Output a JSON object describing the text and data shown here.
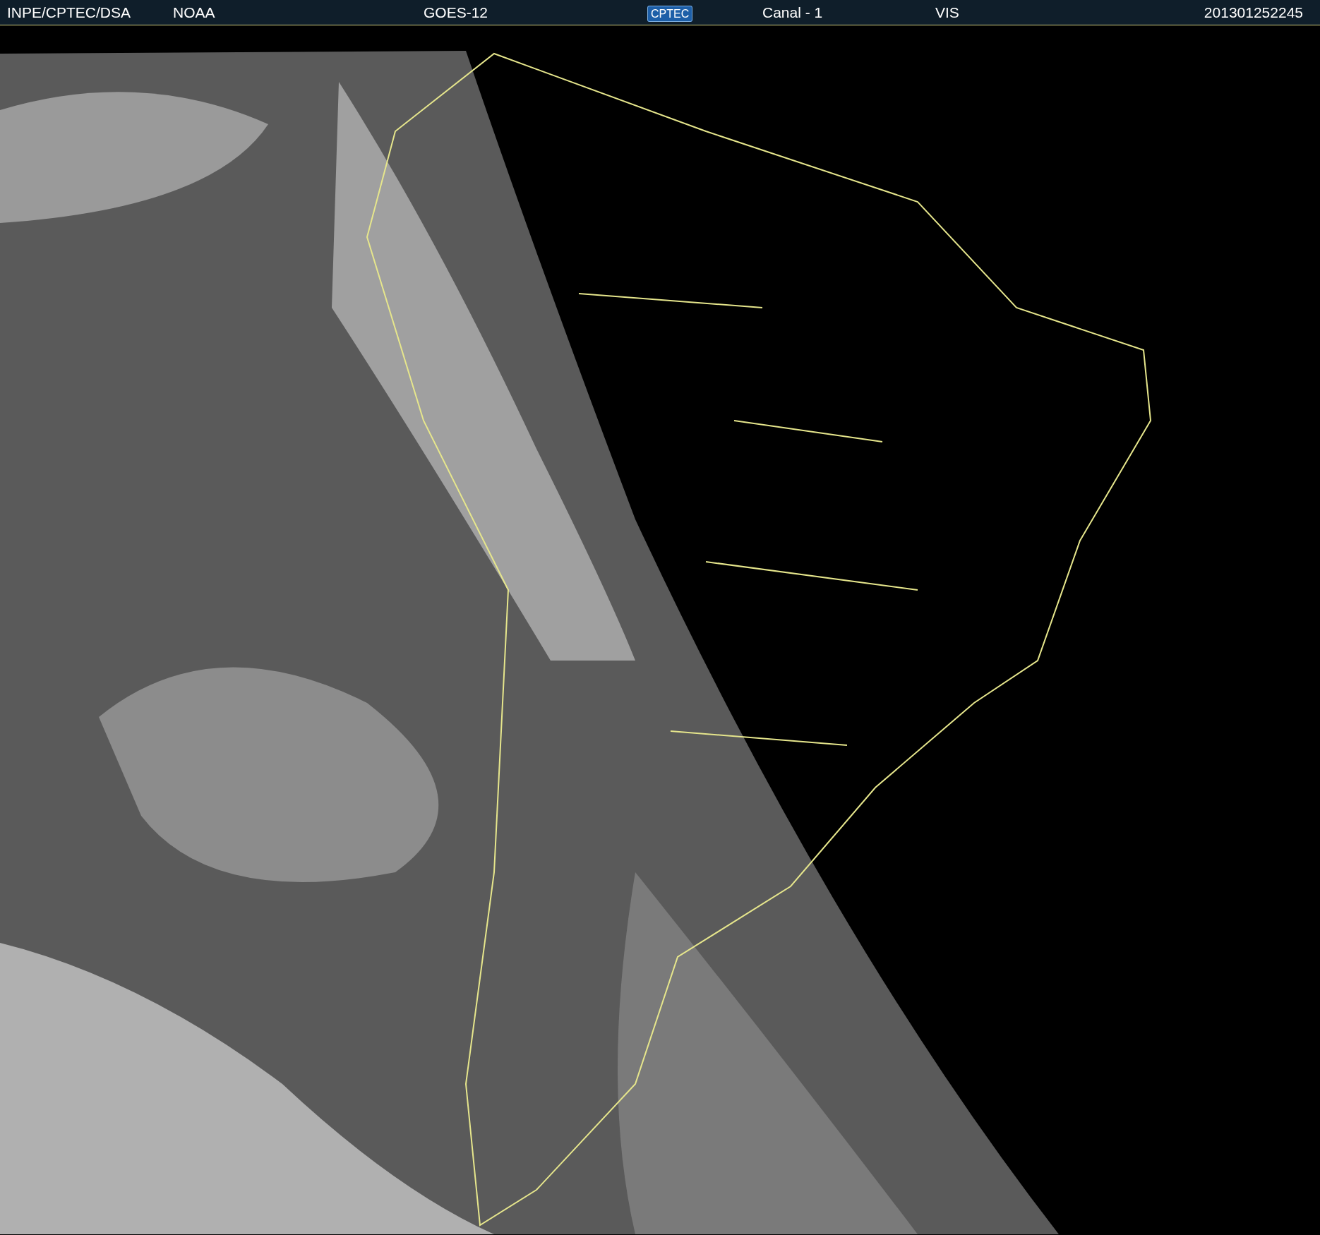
{
  "header": {
    "items": [
      {
        "kind": "text",
        "text": "INPE/CPTEC/DSA"
      },
      {
        "kind": "text",
        "text": "NOAA"
      },
      {
        "kind": "text",
        "text": "GOES-12"
      },
      {
        "kind": "logo",
        "text": "CPTEC"
      },
      {
        "kind": "text",
        "text": "Canal - 1"
      },
      {
        "kind": "text",
        "text": "VIS"
      },
      {
        "kind": "text",
        "text": "201301252245"
      }
    ]
  }
}
